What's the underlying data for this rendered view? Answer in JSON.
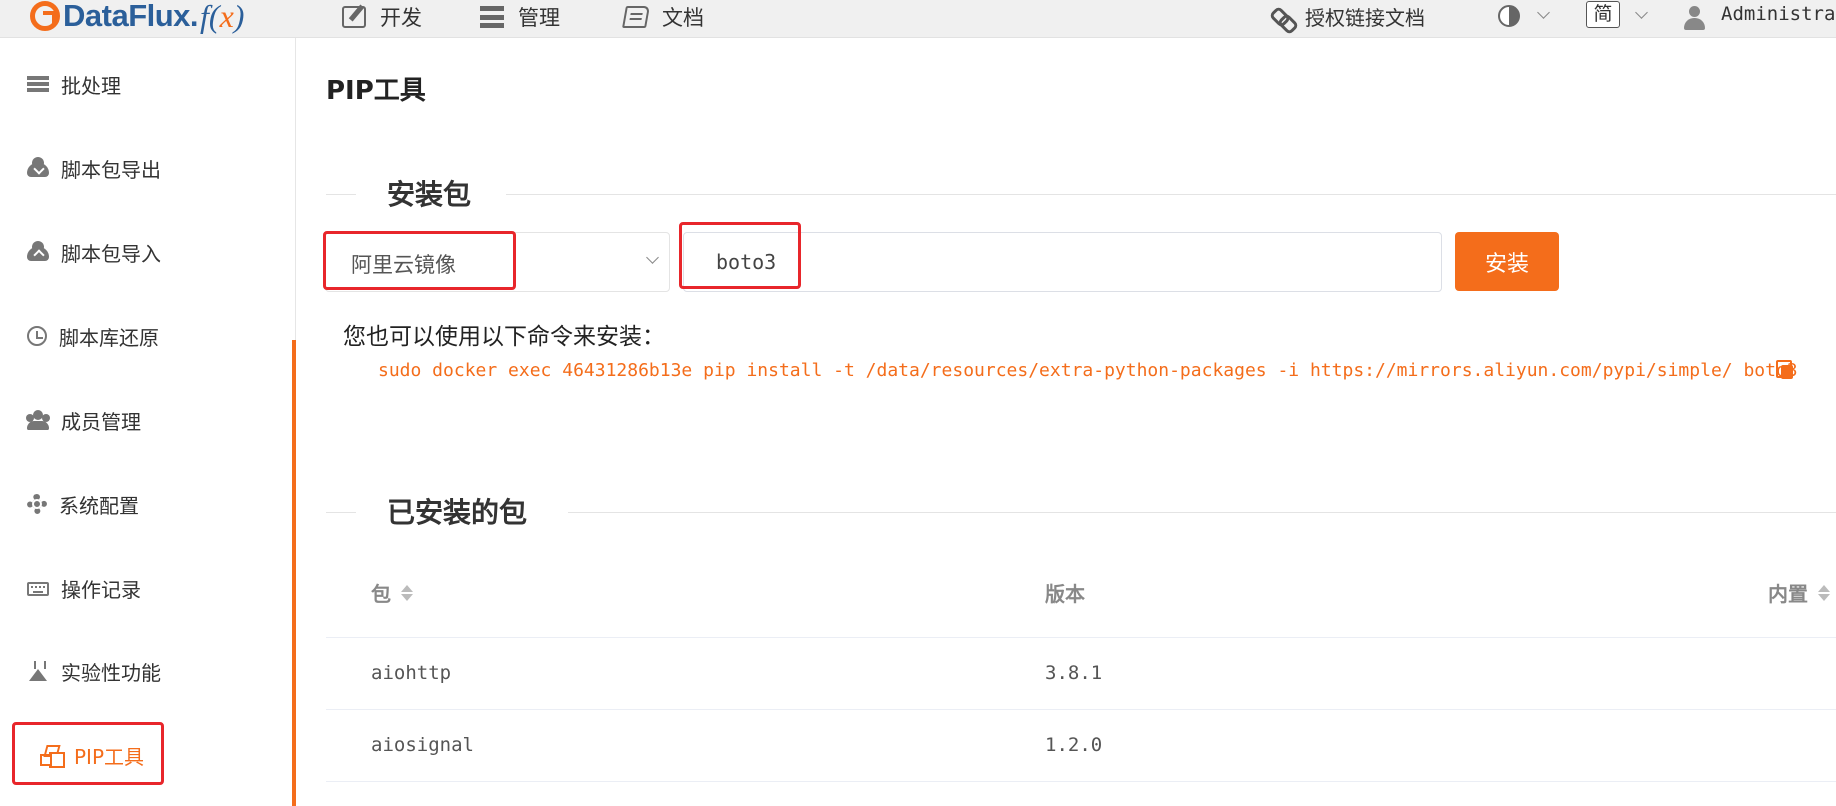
{
  "app": {
    "logo_name": "DataFlux.",
    "logo_f": "f",
    "logo_paren_open": "(",
    "logo_x": "x",
    "logo_paren_close": ")"
  },
  "topnav": {
    "items": [
      {
        "label": "开发",
        "icon": "edit-icon"
      },
      {
        "label": "管理",
        "icon": "server-icon"
      },
      {
        "label": "文档",
        "icon": "book-icon"
      }
    ],
    "auth_link": "授权链接文档",
    "lang": "简",
    "user": "Administrat"
  },
  "sidebar": {
    "items": [
      {
        "label": "批处理",
        "icon": "batch-icon"
      },
      {
        "label": "脚本包导出",
        "icon": "cloud-download-icon"
      },
      {
        "label": "脚本包导入",
        "icon": "cloud-upload-icon"
      },
      {
        "label": "脚本库还原",
        "icon": "history-icon"
      },
      {
        "label": "成员管理",
        "icon": "users-icon"
      },
      {
        "label": "系统配置",
        "icon": "gear-icon"
      },
      {
        "label": "操作记录",
        "icon": "keyboard-icon"
      },
      {
        "label": "实验性功能",
        "icon": "flask-icon"
      },
      {
        "label": "PIP工具",
        "icon": "cubes-icon",
        "active": true
      }
    ]
  },
  "main": {
    "page_title": "PIP工具",
    "install_section_title": "安装包",
    "mirror_select_value": "阿里云镜像",
    "package_input_value": "boto3",
    "install_button": "安装",
    "cmd_hint": "您也可以使用以下命令来安装：",
    "cmd": "sudo docker exec 46431286b13e pip install -t /data/resources/extra-python-packages -i https://mirrors.aliyun.com/pypi/simple/ boto3",
    "installed_section_title": "已安装的包",
    "table": {
      "columns": [
        "包",
        "版本",
        "内置"
      ],
      "rows": [
        {
          "package": "aiohttp",
          "version": "3.8.1"
        },
        {
          "package": "aiosignal",
          "version": "1.2.0"
        }
      ]
    }
  },
  "colors": {
    "accent": "#f46d1b",
    "highlight": "#e8262b",
    "brand_blue": "#2b5f9a"
  }
}
